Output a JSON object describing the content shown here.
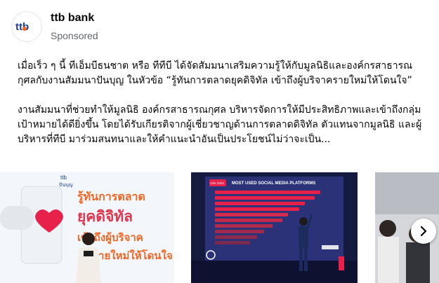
{
  "post": {
    "page_name": "ttb bank",
    "sponsored_label": "Sponsored",
    "logo_text": "ttb",
    "paragraph1": "เมื่อเร็ว ๆ นี้ ทีเอ็มบีธนชาต หรือ ทีทีบี ได้จัดสัมมนาเสริมความรู้ให้กับมูลนิธิและองค์กรสาธารณกุศลกับงานสัมมนาปันบุญ ในหัวข้อ “รู้ทันการตลาดยุคดิจิทัล เข้าถึงผู้บริจาครายใหม่ให้โดนใจ”",
    "paragraph2": "งานสัมมนาที่ช่วยทำให้มูลนิธิ องค์กรสาธารณกุศล บริหารจัดการให้มีประสิทธิภาพและเข้าถึงกลุ่มเป้าหมายได้ดียิ่งขึ้น โดยได้รับเกียรติจากผู้เชี่ยวชาญด้านการตลาดดิจิทัล ตัวแทนจากมูลนิธิ และผู้บริหารที่ทีบี มาร่วมสนทนาและให้คำแนะนำอันเป็นประโยชน์ไม่ว่าจะเป็น..."
  },
  "carousel": {
    "card1": {
      "brand": "ttb",
      "brand_sub": "ปันบุญ",
      "line1": "รู้ทันการตลาด",
      "line2": "ยุคดิจิทัล",
      "line3": "เข้าถึงผู้บริจาค",
      "line4": "รายใหม่ให้โดนใจ"
    },
    "card2": {
      "year_badge": "JAN 2024",
      "slide_title": "MOST USED SOCIAL MEDIA PLATFORMS"
    },
    "next_icon": "chevron-right-icon"
  },
  "colors": {
    "brand_blue": "#1c3f94",
    "brand_orange": "#f26522",
    "accent_red": "#e8214a"
  }
}
